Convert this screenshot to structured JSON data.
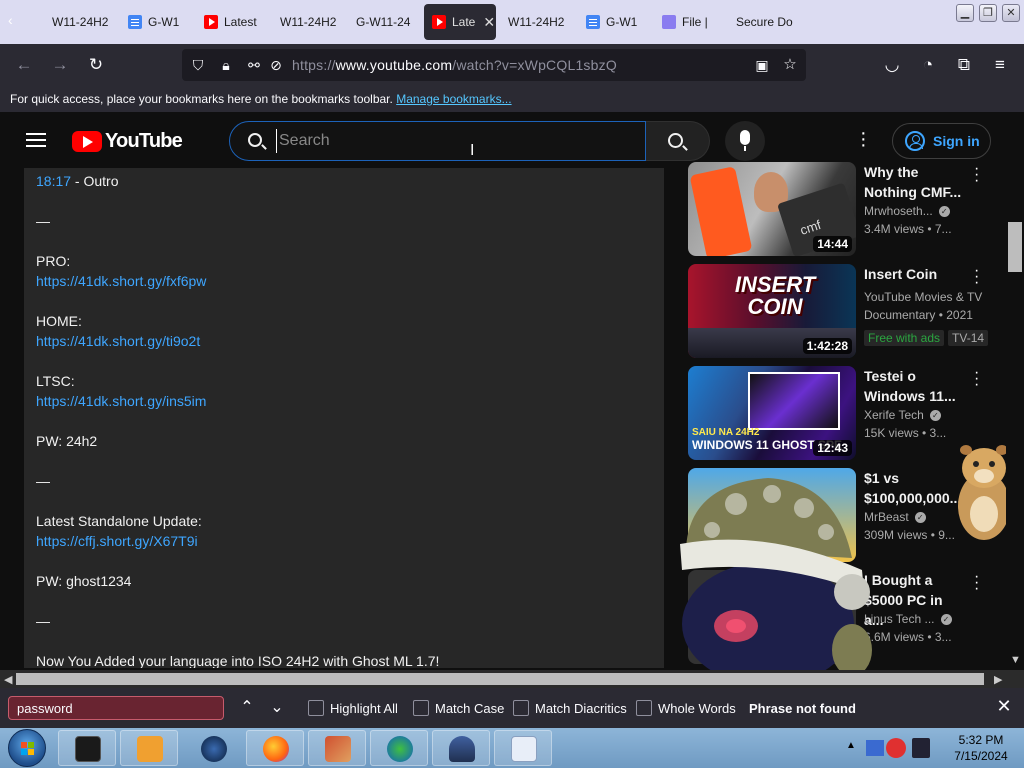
{
  "browser": {
    "tabs": [
      {
        "label": "W11-24H2",
        "icon": "none"
      },
      {
        "label": "G-W1",
        "icon": "doc-icon"
      },
      {
        "label": "Latest",
        "icon": "youtube-icon"
      },
      {
        "label": "W11-24H2",
        "icon": "none"
      },
      {
        "label": "G-W11-24",
        "icon": "none"
      },
      {
        "label": "Late",
        "icon": "youtube-icon",
        "active": true
      },
      {
        "label": "W11-24H2",
        "icon": "none"
      },
      {
        "label": "G-W1",
        "icon": "doc-icon"
      },
      {
        "label": "File |",
        "icon": "file-icon"
      },
      {
        "label": "Secure Do",
        "icon": "none"
      }
    ],
    "url_scheme": "https://",
    "url_host": "www.youtube.com",
    "url_path": "/watch?v=xWpCQL1sbzQ",
    "bookmarks_hint": "For quick access, place your bookmarks here on the bookmarks toolbar.",
    "bookmarks_link": "Manage bookmarks..."
  },
  "youtube": {
    "logo_text": "YouTube",
    "search_placeholder": "Search",
    "signin_label": "Sign in"
  },
  "description": {
    "lines": [
      {
        "ts": "18:17",
        "text": " - Outro"
      },
      {
        "text": "—"
      },
      {
        "text": "PRO:"
      },
      {
        "text": "https://41dk.short.gy/fxf6pw",
        "link": true
      },
      {
        "text": "HOME:"
      },
      {
        "text": "https://41dk.short.gy/ti9o2t",
        "link": true
      },
      {
        "text": "LTSC:"
      },
      {
        "text": "https://41dk.short.gy/ins5im",
        "link": true
      },
      {
        "text": "PW: 24h2"
      },
      {
        "text": "—"
      },
      {
        "text": "Latest Standalone Update:"
      },
      {
        "text": "https://cffj.short.gy/X67T9i",
        "link": true
      },
      {
        "text": "PW: ghost1234"
      },
      {
        "text": "—"
      },
      {
        "text": "Now You Added your language into ISO 24H2 with Ghost ML 1.7!"
      }
    ]
  },
  "recommendations": [
    {
      "title": "Why the Nothing CMF...",
      "channel": "Mrwhoseth...",
      "verified": true,
      "meta": "3.4M views • 7...",
      "duration": "14:44"
    },
    {
      "title": "Insert Coin",
      "channel": "YouTube Movies & TV",
      "meta": "Documentary • 2021",
      "badges": [
        "Free with ads",
        "TV-14"
      ],
      "duration": "1:42:28"
    },
    {
      "title": "Testei o Windows 11...",
      "channel": "Xerife Tech",
      "verified": true,
      "meta": "15K views • 3...",
      "duration": "12:43"
    },
    {
      "title": "$1 vs $100,000,000...",
      "channel": "MrBeast",
      "verified": true,
      "meta": "309M views • 9..."
    },
    {
      "title": "I Bought a $5000 PC in a...",
      "channel": "Linus Tech ...",
      "verified": true,
      "meta": "6.6M views • 3..."
    }
  ],
  "thumb_text": {
    "insert_coin_line1": "INSERT",
    "insert_coin_line2": "COIN",
    "win_line1": "SAIU NA 24H2",
    "win_line2": "WINDOWS 11 GHOST SPE",
    "cmf": "cmf"
  },
  "findbar": {
    "query": "password",
    "highlight_all": "Highlight All",
    "match_case": "Match Case",
    "match_diacritics": "Match Diacritics",
    "whole_words": "Whole Words",
    "status": "Phrase not found"
  },
  "taskbar": {
    "time": "5:32 PM",
    "date": "7/15/2024"
  },
  "colors": {
    "yt_red": "#ff0000",
    "link_blue": "#3ea6ff",
    "find_error": "#692431"
  }
}
